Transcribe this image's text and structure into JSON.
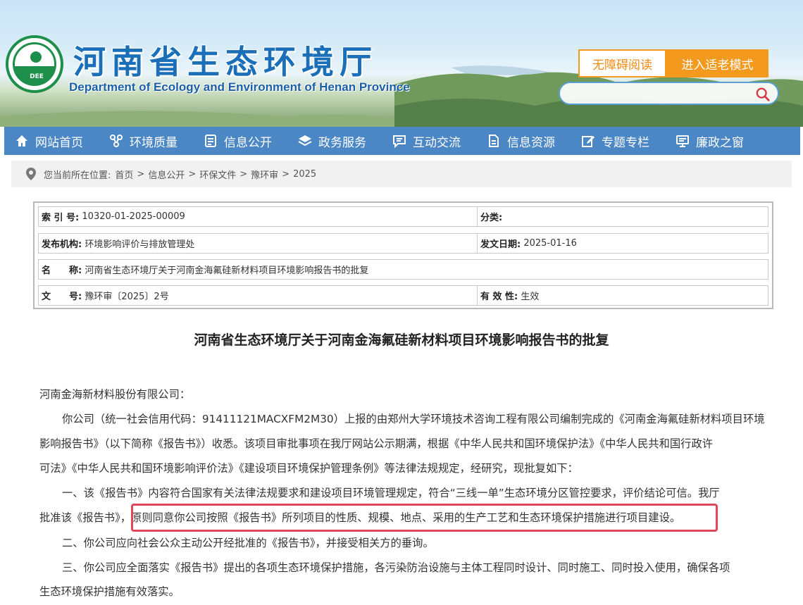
{
  "header": {
    "site_title": "河南省生态环境厅",
    "site_subtitle": "Department of Ecology and Environment of Henan Province",
    "logo_text": "DEE",
    "accessibility_label": "无障碍阅读",
    "elder_mode_label": "进入适老模式",
    "search_placeholder": ""
  },
  "nav": {
    "items": [
      {
        "label": "网站首页",
        "icon": "home-icon"
      },
      {
        "label": "环境质量",
        "icon": "molecule-icon"
      },
      {
        "label": "信息公开",
        "icon": "document-icon"
      },
      {
        "label": "政务服务",
        "icon": "layers-icon"
      },
      {
        "label": "互动交流",
        "icon": "chat-icon"
      },
      {
        "label": "信息资源",
        "icon": "file-icon"
      },
      {
        "label": "专题专栏",
        "icon": "edit-icon"
      },
      {
        "label": "廉政之窗",
        "icon": "monitor-icon"
      }
    ]
  },
  "breadcrumb": {
    "prefix": "您当前所在位置:",
    "items": [
      "首页",
      "信息公开",
      "环保文件",
      "豫环审",
      "2025"
    ],
    "separator": ">"
  },
  "info": {
    "index_label": "索 引 号:",
    "index_value": "10320-01-2025-00009",
    "category_label": "分类:",
    "category_value": "",
    "publisher_label": "发布机构:",
    "publisher_value": "环境影响评价与排放管理处",
    "date_label": "发文日期:",
    "date_value": "2025-01-16",
    "name_label": "名　　称:",
    "name_value": "河南省生态环境厅关于河南金海氟硅新材料项目环境影响报告书的批复",
    "doc_no_label": "文　　号:",
    "doc_no_value": "豫环审〔2025〕2号",
    "validity_label": "有 效 性:",
    "validity_value": "生效"
  },
  "article": {
    "title": "河南省生态环境厅关于河南金海氟硅新材料项目环境影响报告书的批复",
    "salutation": "河南金海新材料股份有限公司：",
    "p1_line1": "你公司（统一社会信用代码：91411121MACXFM2M30）上报的由郑州大学环境技术咨询工程有限公司编制完成的《河南金海氟硅新材料项目环境",
    "p1_line2": "影响报告书》（以下简称《报告书》）收悉。该项目审批事项在我厅网站公示期满，根据《中华人民共和国环境保护法》《中华人民共和国行政许",
    "p1_line3": "可法》《中华人民共和国环境影响评价法》《建设项目环境保护管理条例》等法律法规规定，经研究，现批复如下：",
    "p2_line1": "一、该《报告书》内容符合国家有关法律法规要求和建设项目环境管理规定，符合“三线一单”生态环境分区管控要求，评价结论可信。我厅",
    "p2_line2": "批准该《报告书》，原则同意你公司按照《报告书》所列项目的性质、规模、地点、采用的生产工艺和生态环境保护措施进行项目建设。",
    "p3_line1": "二、你公司应向社会公众主动公开经批准的《报告书》，并接受相关方的垂询。",
    "p4_line1": "三、你公司应全面落实《报告书》提出的各项生态环境保护措施，各污染防治设施与主体工程同时设计、同时施工、同时投入使用，确保各项",
    "p4_line2": "生态环境保护措施有效落实。"
  },
  "colors": {
    "primary_blue": "#4c87c5",
    "title_blue": "#1a6fb8",
    "orange": "#f39a1e",
    "highlight_red": "#e0475b",
    "logo_green": "#1d8f4a"
  }
}
